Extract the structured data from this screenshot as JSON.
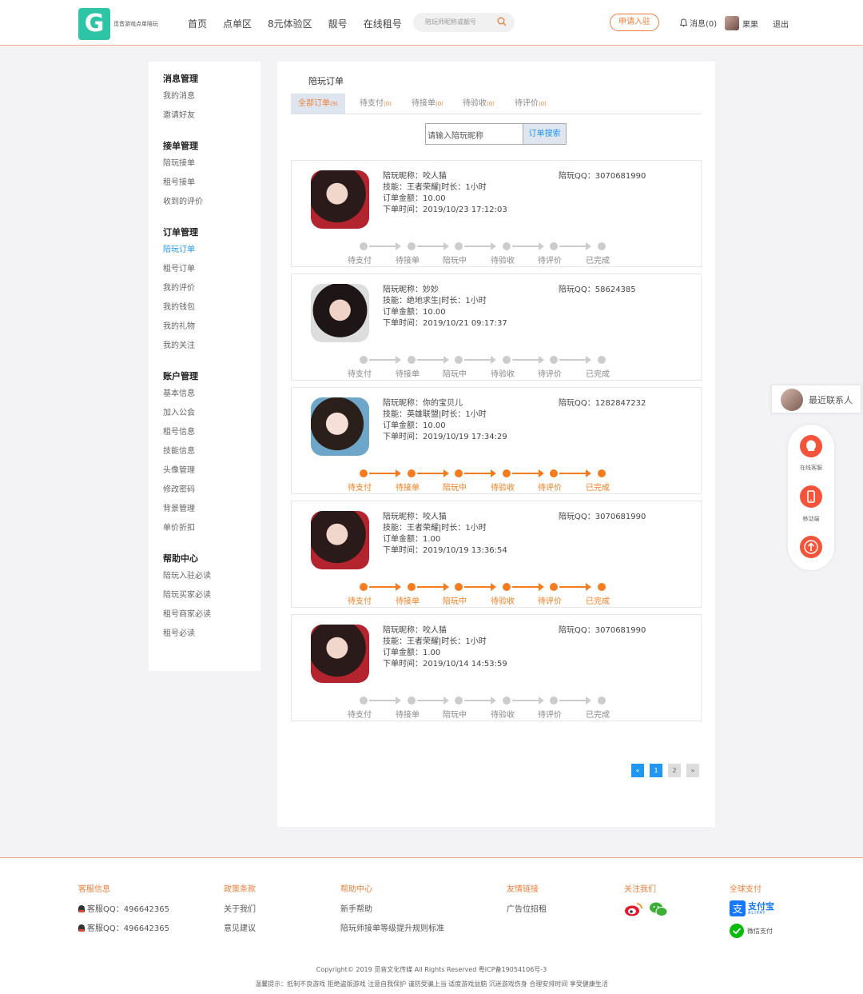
{
  "header": {
    "logo_text": "觅音游戏点单陪玩",
    "nav": [
      "首页",
      "点单区",
      "8元体验区",
      "靓号",
      "在线租号"
    ],
    "search_placeholder": "陪玩师昵称或靓号",
    "apply_label": "申请入驻",
    "message_label": "消息(0)",
    "user_name": "果果",
    "logout_label": "退出"
  },
  "sidebar": {
    "sections": [
      {
        "title": "消息管理",
        "items": [
          "我的消息",
          "邀请好友"
        ]
      },
      {
        "title": "接单管理",
        "items": [
          "陪玩接单",
          "租号接单",
          "收到的评价"
        ]
      },
      {
        "title": "订单管理",
        "items": [
          "陪玩订单",
          "租号订单",
          "我的评价",
          "我的钱包",
          "我的礼物",
          "我的关注"
        ]
      },
      {
        "title": "账户管理",
        "items": [
          "基本信息",
          "加入公会",
          "租号信息",
          "技能信息",
          "头像管理",
          "修改密码",
          "背景管理",
          "单价折扣"
        ]
      },
      {
        "title": "帮助中心",
        "items": [
          "陪玩入驻必读",
          "陪玩买家必读",
          "租号商家必读",
          "租号必读"
        ]
      }
    ],
    "active_item": "陪玩订单"
  },
  "main": {
    "title": "陪玩订单",
    "tabs": [
      {
        "label": "全部订单",
        "count": "(9)"
      },
      {
        "label": "待支付",
        "count": "(0)"
      },
      {
        "label": "待接单",
        "count": "(0)"
      },
      {
        "label": "待验收",
        "count": "(0)"
      },
      {
        "label": "待评价",
        "count": "(0)"
      }
    ],
    "search_placeholder": "请输入陪玩昵称",
    "search_button": "订单搜索",
    "steps": [
      "待支付",
      "待接单",
      "陪玩中",
      "待验收",
      "待评价",
      "已完成"
    ],
    "orders": [
      {
        "nick": "陪玩昵称：咬人猫",
        "skill": "技能：王者荣耀|时长：1小时",
        "amount": "订单金额：10.00",
        "time": "下单时间：2019/10/23 17:12:03",
        "qq": "陪玩QQ：3070681990",
        "completed": false
      },
      {
        "nick": "陪玩昵称：妙妙",
        "skill": "技能：绝地求生|时长：1小时",
        "amount": "订单金额：10.00",
        "time": "下单时间：2019/10/21 09:17:37",
        "qq": "陪玩QQ：58624385",
        "completed": false
      },
      {
        "nick": "陪玩昵称：你的宝贝儿",
        "skill": "技能：英雄联盟|时长：1小时",
        "amount": "订单金额：10.00",
        "time": "下单时间：2019/10/19 17:34:29",
        "qq": "陪玩QQ：1282847232",
        "completed": true
      },
      {
        "nick": "陪玩昵称：咬人猫",
        "skill": "技能：王者荣耀|时长：1小时",
        "amount": "订单金额：1.00",
        "time": "下单时间：2019/10/19 13:36:54",
        "qq": "陪玩QQ：3070681990",
        "completed": true
      },
      {
        "nick": "陪玩昵称：咬人猫",
        "skill": "技能：王者荣耀|时长：1小时",
        "amount": "订单金额：1.00",
        "time": "下单时间：2019/10/14 14:53:59",
        "qq": "陪玩QQ：3070681990",
        "completed": false
      }
    ],
    "pager": [
      "«",
      "1",
      "2",
      "»"
    ]
  },
  "float": {
    "recent_contacts": "最近联系人",
    "service_label": "在线客服",
    "mobile_label": "移动端"
  },
  "footer": {
    "service_title": "客服信息",
    "service_items": [
      "客服QQ：496642365",
      "客服QQ：496642365"
    ],
    "policy_title": "政策条款",
    "policy_items": [
      "关于我们",
      "意见建议"
    ],
    "help_title": "帮助中心",
    "help_items": [
      "新手帮助",
      "陪玩师接单等级提升规则标准"
    ],
    "links_title": "友情链接",
    "links_items": [
      "广告位招租"
    ],
    "follow_title": "关注我们",
    "pay_title": "全球支付",
    "alipay_label": "支付宝",
    "alipay_sub": "ALIPAY",
    "wechat_pay": "微信支付",
    "copyright": "Copyright© 2019 觅音文化传媒 All Rights Reserved 粤ICP备19054106号-3",
    "tips": "温馨提示：抵制不良游戏 拒绝盗版游戏 注意自我保护 谨防受骗上当 适度游戏益脑 沉迷游戏伤身 合理安排时间 享受健康生活"
  },
  "colors": {
    "accent": "#f07e3b",
    "active_blue": "#2196f3",
    "progress_done": "#f57c1f",
    "progress_todo": "#cccccc"
  }
}
